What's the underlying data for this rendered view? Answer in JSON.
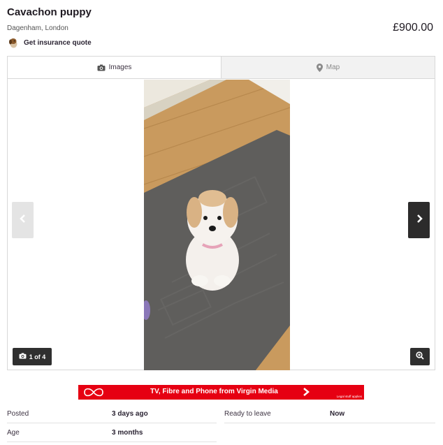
{
  "listing": {
    "title": "Cavachon puppy",
    "location": "Dagenham, London",
    "price": "£900.00",
    "insurance_link": "Get insurance quote"
  },
  "gallery": {
    "tabs": [
      {
        "label": "Images",
        "icon": "camera-icon",
        "active": true
      },
      {
        "label": "Map",
        "icon": "map-pin-icon",
        "active": false
      }
    ],
    "counter": "1 of 4",
    "prev_icon": "chevron-left-icon",
    "next_icon": "chevron-right-icon",
    "zoom_icon": "zoom-in-icon"
  },
  "ad": {
    "text": "TV, Fibre and Phone from Virgin Media",
    "small_print": "Legal stuff applies",
    "color": "#e60012"
  },
  "details": [
    {
      "label": "Posted",
      "value": "3 days ago"
    },
    {
      "label": "Ready to leave",
      "value": "Now"
    },
    {
      "label": "Age",
      "value": "3 months"
    }
  ]
}
